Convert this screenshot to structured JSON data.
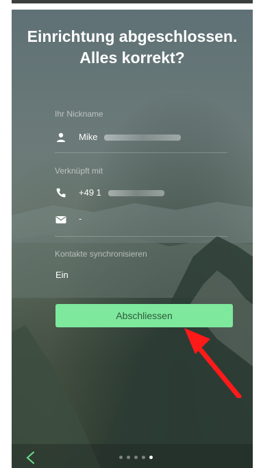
{
  "header": {
    "title": "Einrichtung abgeschlossen. Alles korrekt?"
  },
  "nickname": {
    "label": "Ihr Nickname",
    "value": "Mike",
    "icon": "person-icon"
  },
  "linked": {
    "label": "Verknüpft mit",
    "phone": "+49 1",
    "phone_icon": "phone-icon",
    "email": "-",
    "email_icon": "mail-icon"
  },
  "sync": {
    "label": "Kontakte synchronisieren",
    "value": "Ein"
  },
  "actions": {
    "finish_label": "Abschliessen"
  },
  "pagination": {
    "total": 5,
    "active": 5
  },
  "colors": {
    "button": "#7ee89d",
    "arrow": "#ff1a1a",
    "back": "#6fe08e"
  }
}
